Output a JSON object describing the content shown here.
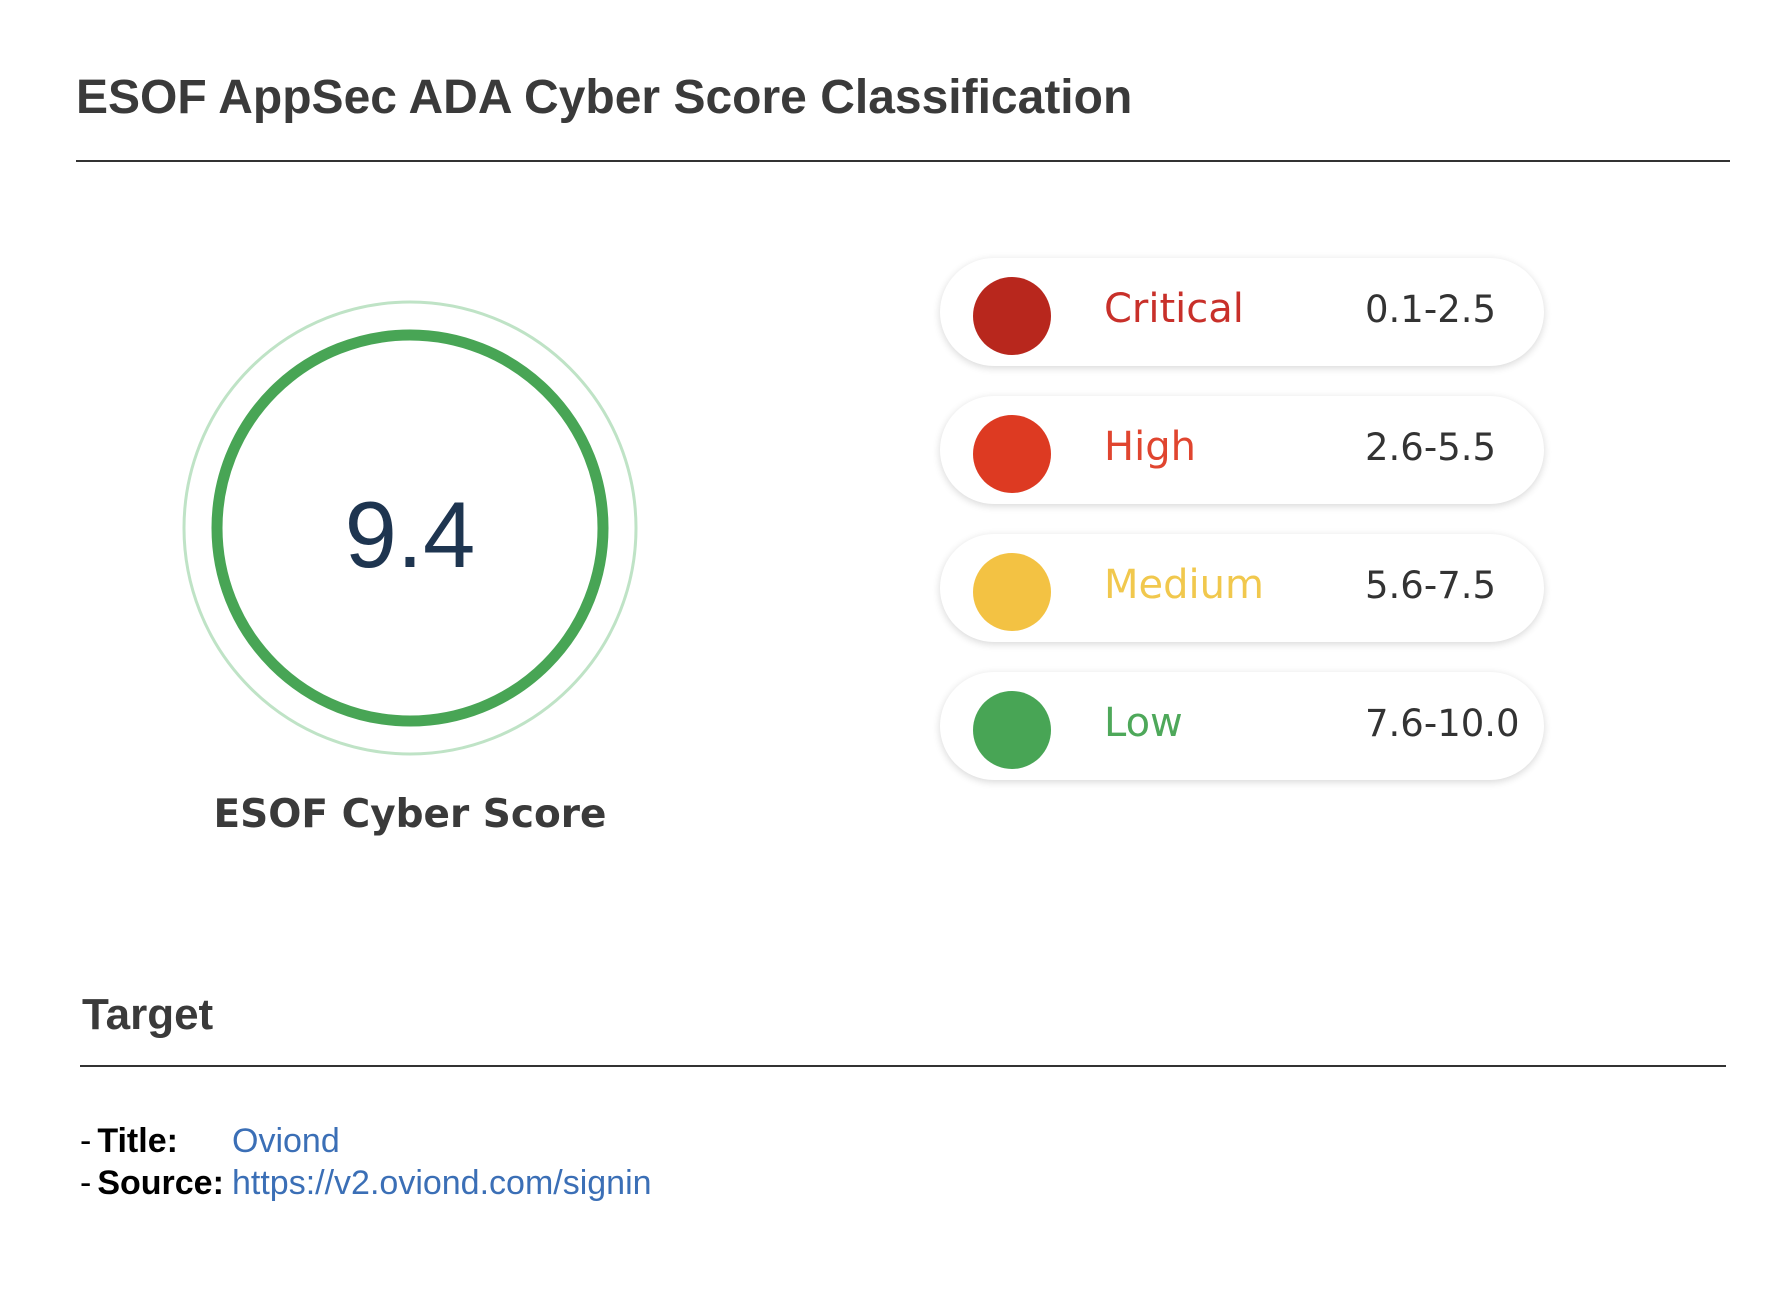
{
  "header": {
    "title": "ESOF AppSec ADA Cyber Score Classification"
  },
  "score": {
    "value": "9.4",
    "label": "ESOF Cyber Score",
    "ring_color": "#48a555",
    "outer_ring_color": "#bfe3c6"
  },
  "legend": [
    {
      "level": "Critical",
      "range": "0.1-2.5",
      "color": "#b8271d",
      "text_color": "#c8302a"
    },
    {
      "level": "High",
      "range": "2.6-5.5",
      "color": "#dd3a22",
      "text_color": "#e0452f"
    },
    {
      "level": "Medium",
      "range": "5.6-7.5",
      "color": "#f3c243",
      "text_color": "#f1c84d"
    },
    {
      "level": "Low",
      "range": "7.6-10.0",
      "color": "#48a555",
      "text_color": "#4ea85a"
    }
  ],
  "target": {
    "heading": "Target",
    "title_key": "Title:",
    "title_value": "Oviond",
    "source_key": "Source:",
    "source_value": "https://v2.oviond.com/signin",
    "value_color": "#3b6fb6"
  }
}
